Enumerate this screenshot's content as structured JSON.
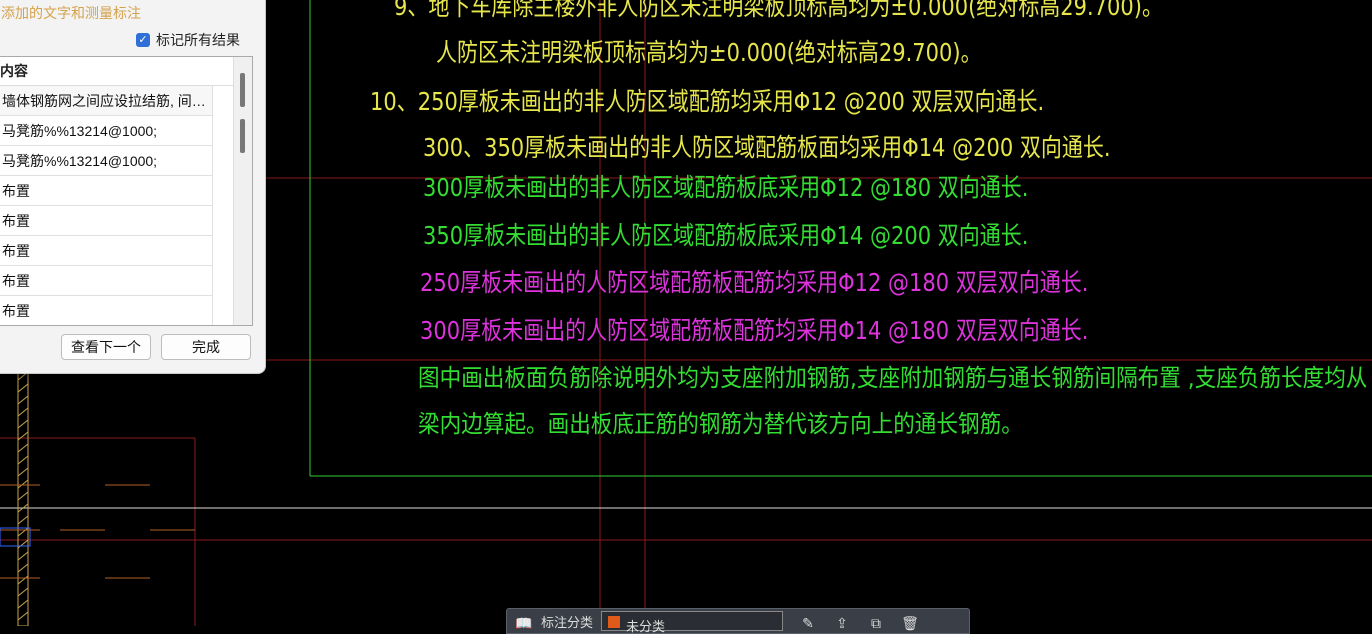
{
  "drawing": {
    "notes": [
      {
        "text": "9、地下车库除主楼外非人防区未注明梁板顶标高均为±0.000(绝对标高29.700)。",
        "color": "yellow"
      },
      {
        "text": "人防区未注明梁板顶标高均为±0.000(绝对标高29.700)。",
        "color": "yellow"
      },
      {
        "text": "10、250厚板未画出的非人防区域配筋均采用Φ12 @200 双层双向通长.",
        "color": "yellow"
      },
      {
        "text": "300、350厚板未画出的非人防区域配筋板面均采用Φ14 @200 双向通长.",
        "color": "yellow"
      },
      {
        "text": "300厚板未画出的非人防区域配筋板底采用Φ12 @180 双向通长.",
        "color": "green"
      },
      {
        "text": "350厚板未画出的非人防区域配筋板底采用Φ14 @200 双向通长.",
        "color": "green"
      },
      {
        "text": "250厚板未画出的人防区域配筋板配筋均采用Φ12 @180 双层双向通长.",
        "color": "magenta"
      },
      {
        "text": "300厚板未画出的人防区域配筋板配筋均采用Φ14 @180 双层双向通长.",
        "color": "magenta"
      },
      {
        "text": "图中画出板面负筋除说明外均为支座附加钢筋,支座附加钢筋与通长钢筋间隔布置 ,支座负筋长度均从",
        "color": "green"
      },
      {
        "text": "梁内边算起。画出板底正筋的钢筋为替代该方向上的通长钢筋。",
        "color": "green"
      }
    ]
  },
  "dialog": {
    "hint": "添加的文字和测量标注",
    "mark_all_label": "标记所有结果",
    "mark_all_checked": true,
    "column_header": "内容",
    "rows": [
      "墙体钢筋网之间应设拉结筋, 间…",
      "马凳筋%%13214@1000;",
      "马凳筋%%13214@1000;",
      "布置",
      "布置",
      "布置",
      "布置",
      "布置"
    ],
    "next_button": "查看下一个",
    "done_button": "完成"
  },
  "toolbar": {
    "label": "标注分类",
    "layer": "未分类"
  },
  "colors": {
    "yellow": "#e6e64c",
    "green": "#33dd33",
    "magenta": "#dd33dd",
    "accent": "#2f6fd6"
  }
}
